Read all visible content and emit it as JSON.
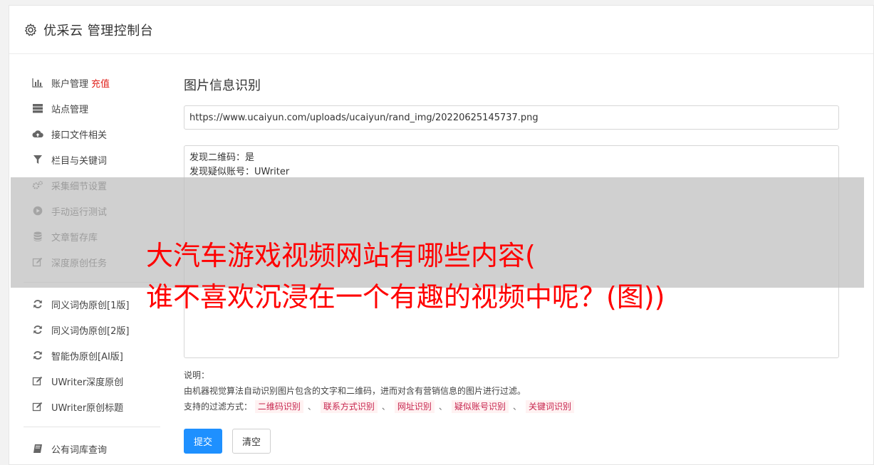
{
  "header": {
    "title": "优采云 管理控制台",
    "icon": "gear-icon"
  },
  "sidebar": {
    "group1": [
      {
        "label": "账户管理",
        "badge": "充值",
        "icon": "bar-chart-icon"
      },
      {
        "label": "站点管理",
        "icon": "server-icon"
      },
      {
        "label": "接口文件相关",
        "icon": "cloud-upload-icon"
      },
      {
        "label": "栏目与关键词",
        "icon": "filter-icon"
      },
      {
        "label": "采集细节设置",
        "icon": "cogs-icon"
      },
      {
        "label": "手动运行测试",
        "icon": "play-circle-icon"
      },
      {
        "label": "文章暂存库",
        "icon": "database-icon"
      },
      {
        "label": "深度原创任务",
        "icon": "edit-icon"
      }
    ],
    "group2": [
      {
        "label": "同义词伪原创[1版]",
        "icon": "refresh-icon"
      },
      {
        "label": "同义词伪原创[2版]",
        "icon": "refresh-icon"
      },
      {
        "label": "智能伪原创[AI版]",
        "icon": "refresh-icon"
      },
      {
        "label": "UWriter深度原创",
        "icon": "edit-icon"
      },
      {
        "label": "UWriter原创标题",
        "icon": "edit-icon"
      }
    ],
    "group3": [
      {
        "label": "公有词库查询",
        "icon": "book-icon"
      }
    ]
  },
  "main": {
    "title": "图片信息识别",
    "url_value": "https://www.ucaiyun.com/uploads/ucaiyun/rand_img/20220625145737.png",
    "result_lines": [
      "发现二维码：是",
      "发现疑似账号：UWriter"
    ],
    "notes_label": "说明：",
    "notes_desc": "由机器视觉算法自动识别图片包含的文字和二维码，进而对含有营销信息的图片进行过滤。",
    "filter_label": "支持的过滤方式：",
    "filter_tags": [
      "二维码识别",
      "联系方式识别",
      "网址识别",
      "疑似账号识别",
      "关键词识别"
    ],
    "filter_sep": "、",
    "submit_label": "提交",
    "clear_label": "清空"
  },
  "overlay": {
    "line1": "大汽车游戏视频网站有哪些内容(",
    "line2": "谁不喜欢沉浸在一个有趣的视频中呢？(图))"
  },
  "colors": {
    "primary": "#1e90ff",
    "badge": "#e0211b",
    "overlay_text": "#ff0000"
  }
}
